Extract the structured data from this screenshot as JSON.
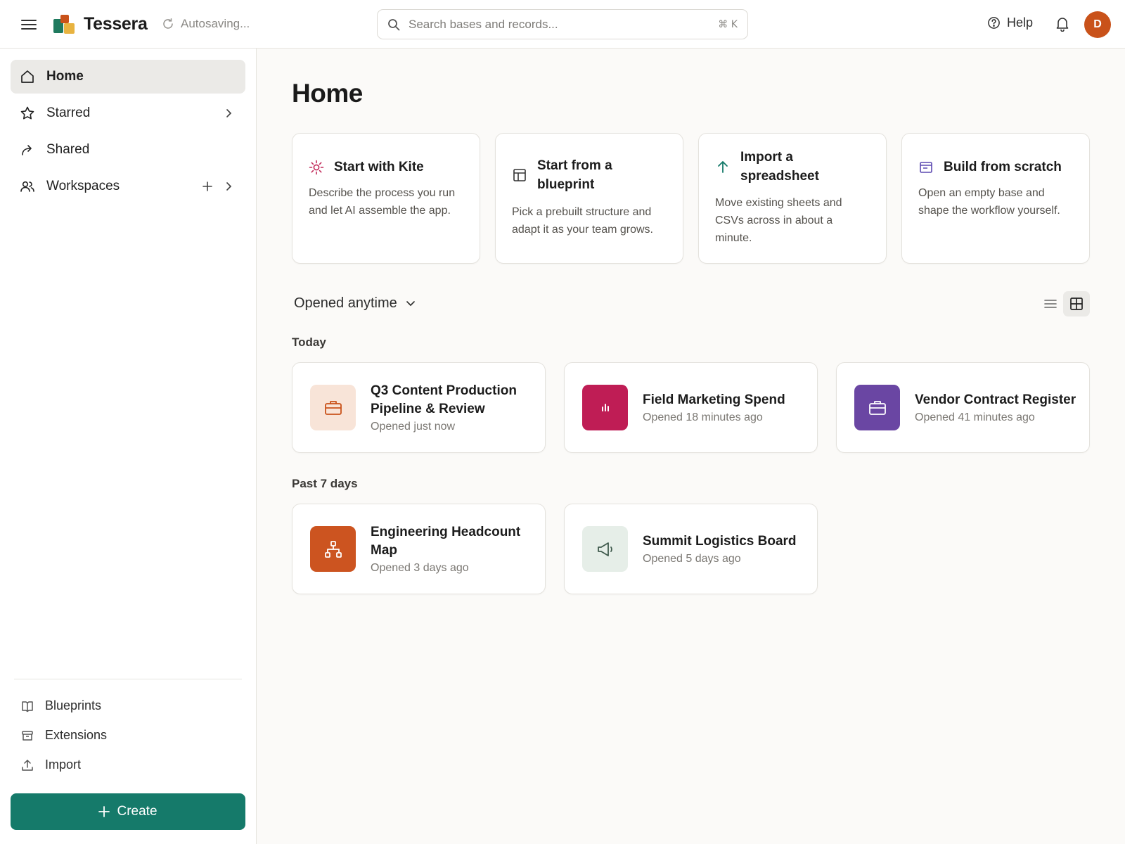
{
  "header": {
    "brand": "Tessera",
    "autosave": "Autosaving...",
    "search_placeholder": "Search bases and records...",
    "search_shortcut": "⌘ K",
    "help_label": "Help",
    "avatar_initial": "D"
  },
  "sidebar": {
    "items": [
      {
        "label": "Home"
      },
      {
        "label": "Starred"
      },
      {
        "label": "Shared"
      },
      {
        "label": "Workspaces"
      }
    ],
    "bottom": [
      {
        "label": "Blueprints"
      },
      {
        "label": "Extensions"
      },
      {
        "label": "Import"
      }
    ],
    "create_label": "Create"
  },
  "main": {
    "title": "Home",
    "start_cards": [
      {
        "title": "Start with Kite",
        "description": "Describe the process you run and let AI assemble the app."
      },
      {
        "title": "Start from a blueprint",
        "description": "Pick a prebuilt structure and adapt it as your team grows."
      },
      {
        "title": "Import a spreadsheet",
        "description": "Move existing sheets and CSVs across in about a minute."
      },
      {
        "title": "Build from scratch",
        "description": "Open an empty base and shape the workflow yourself."
      }
    ],
    "filter_label": "Opened anytime",
    "sections": {
      "today": "Today",
      "past": "Past 7 days"
    },
    "records": [
      {
        "title": "Q3 Content Production Pipeline & Review",
        "subtitle": "Opened just now",
        "color": "#f8e4d8",
        "icon": "briefcase-icon"
      },
      {
        "title": "Field Marketing Spend",
        "subtitle": "Opened 18 minutes ago",
        "color": "#bf1d55",
        "icon": "bar-chart-icon"
      },
      {
        "title": "Vendor Contract Register",
        "subtitle": "Opened 41 minutes ago",
        "color": "#6a46a3",
        "icon": "briefcase-icon"
      },
      {
        "title": "Engineering Headcount Map",
        "subtitle": "Opened 3 days ago",
        "color": "#cc5420",
        "icon": "org-chart-icon"
      },
      {
        "title": "Summit Logistics Board",
        "subtitle": "Opened 5 days ago",
        "color": "#e6eee8",
        "icon": "megaphone-icon"
      }
    ]
  }
}
